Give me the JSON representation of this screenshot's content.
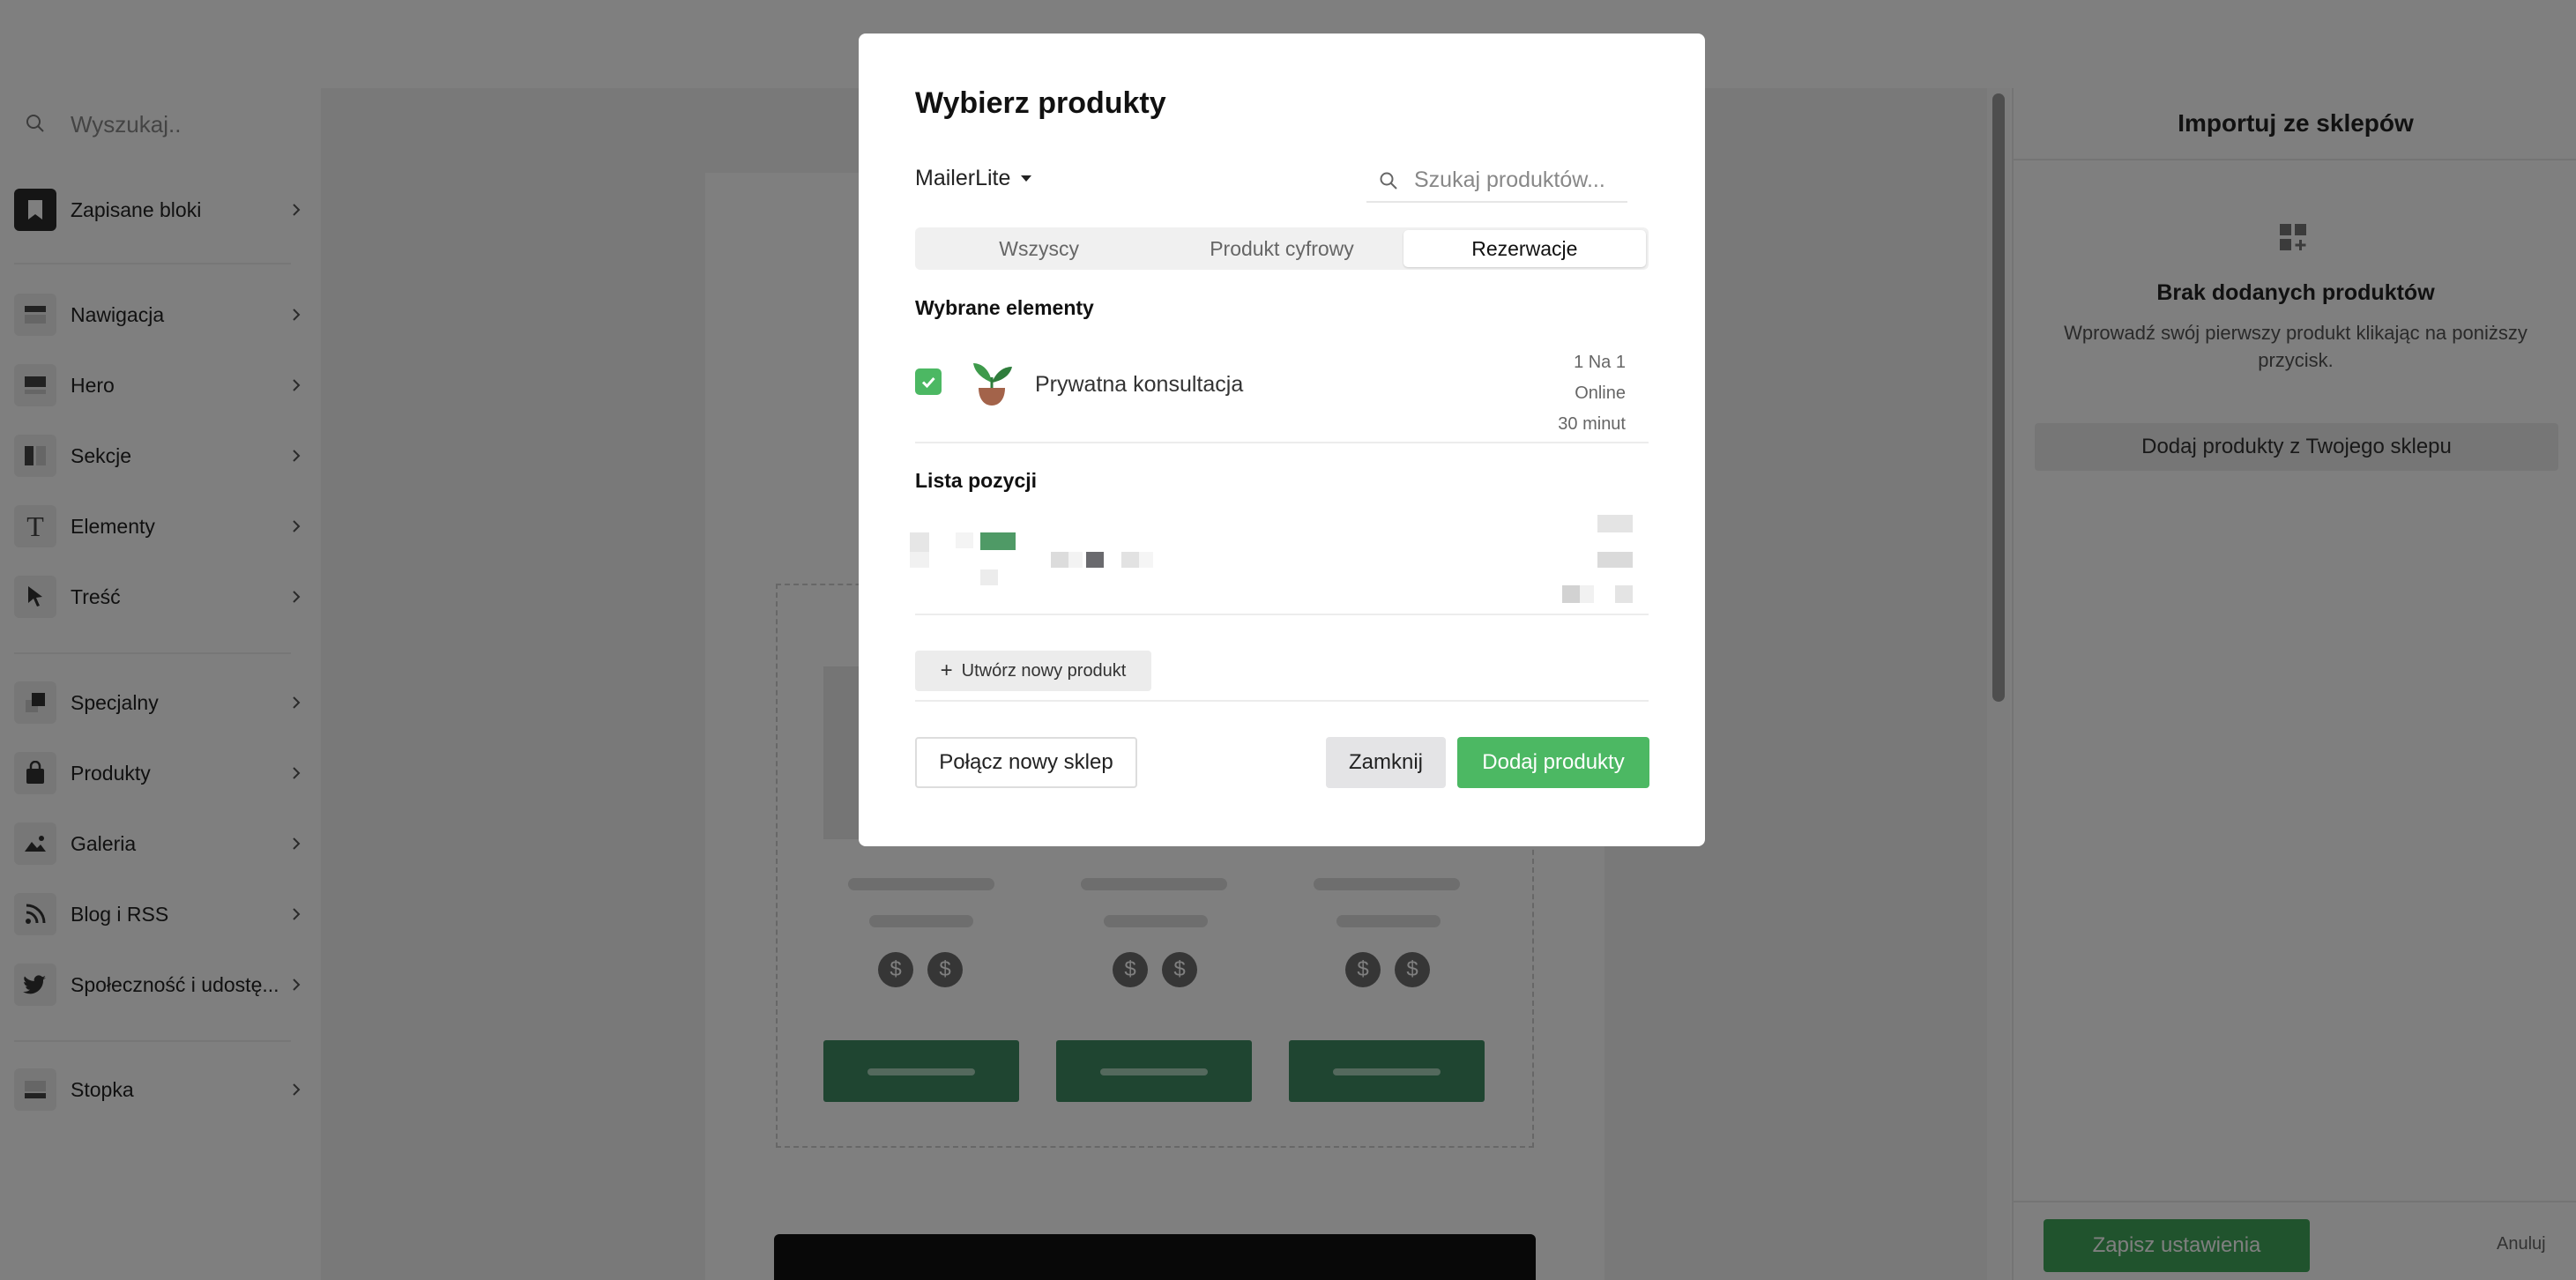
{
  "sidebar": {
    "search_placeholder": "Wyszukaj..",
    "items": [
      {
        "label": "Zapisane bloki",
        "icon": "bookmark-icon"
      },
      {
        "label": "Nawigacja",
        "icon": "navigation-icon"
      },
      {
        "label": "Hero",
        "icon": "hero-icon"
      },
      {
        "label": "Sekcje",
        "icon": "sections-icon"
      },
      {
        "label": "Elementy",
        "icon": "text-icon"
      },
      {
        "label": "Treść",
        "icon": "cursor-icon"
      },
      {
        "label": "Specjalny",
        "icon": "special-icon"
      },
      {
        "label": "Produkty",
        "icon": "bag-icon"
      },
      {
        "label": "Galeria",
        "icon": "image-icon"
      },
      {
        "label": "Blog i RSS",
        "icon": "rss-icon"
      },
      {
        "label": "Społeczność i udostę...",
        "icon": "twitter-icon"
      },
      {
        "label": "Stopka",
        "icon": "footer-icon"
      }
    ]
  },
  "canvas": {
    "coin_symbol": "$"
  },
  "right_panel": {
    "title": "Importuj ze sklepów",
    "empty_title": "Brak dodanych produktów",
    "empty_text": "Wprowadź swój pierwszy produkt klikając na poniższy przycisk.",
    "add_button": "Dodaj produkty z Twojego sklepu",
    "save_button": "Zapisz ustawienia",
    "cancel_link": "Anuluj"
  },
  "modal": {
    "title": "Wybierz produkty",
    "store_selector": "MailerLite",
    "search_placeholder": "Szukaj produktów...",
    "tabs": [
      {
        "label": "Wszyscy",
        "active": false
      },
      {
        "label": "Produkt cyfrowy",
        "active": false
      },
      {
        "label": "Rezerwacje",
        "active": true
      }
    ],
    "selected_section_title": "Wybrane elementy",
    "selected_item": {
      "name": "Prywatna konsultacja",
      "checked": true,
      "meta": [
        "1 Na 1",
        "Online",
        "30 minut"
      ]
    },
    "list_section_title": "Lista pozycji",
    "create_button": "Utwórz nowy produkt",
    "connect_button": "Połącz nowy sklep",
    "close_button": "Zamknij",
    "add_button": "Dodaj produkty"
  },
  "colors": {
    "accent_green": "#4cb863",
    "canvas_button_green": "#3f8b63",
    "save_green": "#41a75b"
  }
}
